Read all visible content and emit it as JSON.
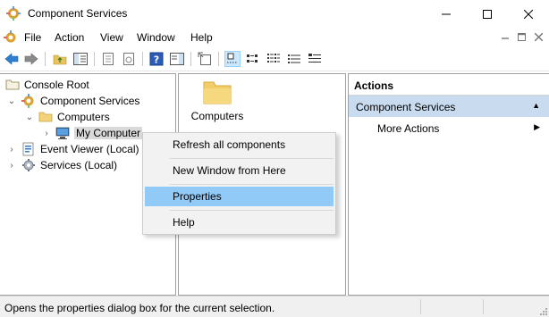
{
  "window": {
    "title": "Component Services"
  },
  "menu": {
    "items": [
      "File",
      "Action",
      "View",
      "Window",
      "Help"
    ]
  },
  "toolbar": {
    "buttons": [
      "back-icon",
      "forward-icon",
      "up-icon",
      "show-hide-console-tree-icon",
      "export-list-icon",
      "refresh-icon",
      "help-icon",
      "show-hide-action-pane-icon",
      "new-window-icon",
      "large-icons-view-icon",
      "small-icons-view-icon",
      "list-view-icon",
      "detail-view-icon"
    ]
  },
  "tree": {
    "root": "Console Root",
    "component_services": "Component Services",
    "computers": "Computers",
    "my_computer": "My Computer",
    "event_viewer": "Event Viewer (Local)",
    "services": "Services (Local)"
  },
  "list": {
    "items": [
      "Computers"
    ]
  },
  "actions": {
    "header": "Actions",
    "section": "Component Services",
    "more": "More Actions"
  },
  "context_menu": {
    "items": [
      "Refresh all components",
      "New Window from Here",
      "Properties",
      "Help"
    ],
    "highlighted": "Properties"
  },
  "status": {
    "text": "Opens the properties dialog box for the current selection."
  },
  "colors": {
    "selection": "#91c9f7",
    "actions_section": "#c9dbef",
    "context_bg": "#f2f2f2"
  }
}
